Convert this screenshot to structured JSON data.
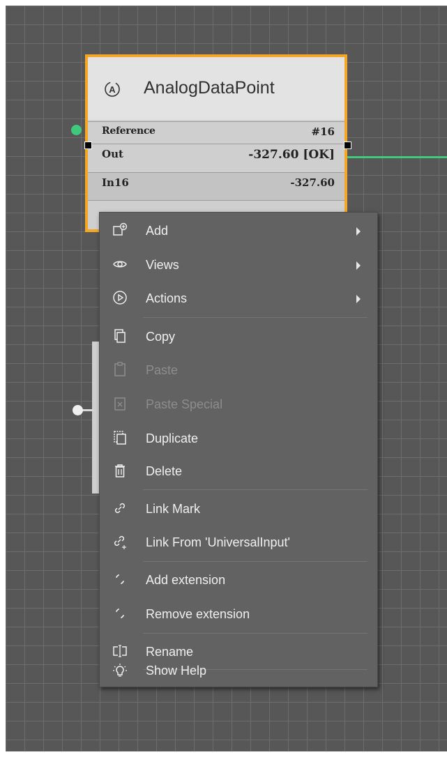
{
  "node": {
    "title": "AnalogDataPoint",
    "rows": [
      {
        "label": "Reference",
        "value": "#16"
      },
      {
        "label": "Out",
        "value": "-327.60 [OK]"
      },
      {
        "label": "In16",
        "value": "-327.60"
      }
    ]
  },
  "menu": {
    "items": [
      {
        "label": "Add",
        "icon": "add-icon",
        "submenu": true
      },
      {
        "label": "Views",
        "icon": "eye-icon",
        "submenu": true
      },
      {
        "label": "Actions",
        "icon": "play-icon",
        "submenu": true
      },
      {
        "label": "Copy",
        "icon": "copy-icon"
      },
      {
        "label": "Paste",
        "icon": "paste-icon",
        "disabled": true
      },
      {
        "label": "Paste Special",
        "icon": "paste-special-icon",
        "disabled": true
      },
      {
        "label": "Duplicate",
        "icon": "duplicate-icon"
      },
      {
        "label": "Delete",
        "icon": "trash-icon"
      },
      {
        "label": "Link Mark",
        "icon": "link-icon"
      },
      {
        "label": "Link From 'UniversalInput'",
        "icon": "link-from-icon"
      },
      {
        "label": "Add extension",
        "icon": "extension-icon"
      },
      {
        "label": "Remove extension",
        "icon": "extension-icon"
      },
      {
        "label": "Rename",
        "icon": "rename-icon"
      },
      {
        "label": "Show Help",
        "icon": "lightbulb-icon"
      }
    ]
  },
  "colors": {
    "canvas": "#575757",
    "grid": "#6d6d6d",
    "selection": "#f5a623",
    "wire": "#3ec97c",
    "menu_bg": "#626262"
  }
}
